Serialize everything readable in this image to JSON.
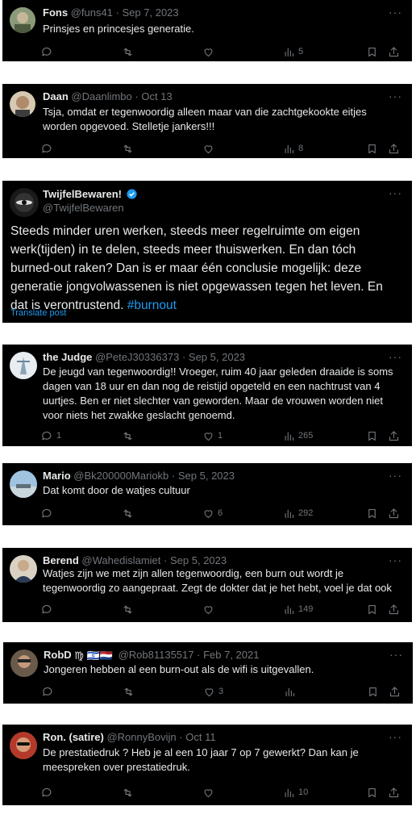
{
  "tweets": [
    {
      "name": "Fons",
      "handle": "@funs41",
      "date": "Sep 7, 2023",
      "text": "Prinsjes en princesjes generatie.",
      "replies": "",
      "reposts": "",
      "likes": "",
      "views": "5"
    },
    {
      "name": "Daan",
      "handle": "@Daanlimbo",
      "date": "Oct 13",
      "text": "Tsja, omdat er tegenwoordig alleen maar van die zachtgekookte eitjes worden opgevoed. Stelletje jankers!!!",
      "replies": "",
      "reposts": "",
      "likes": "",
      "views": "8"
    },
    {
      "name": "TwijfelBewaren!",
      "handle": "@TwijfelBewaren",
      "text": "Steeds minder uren werken, steeds meer regelruimte om eigen werk(tijden) in te delen, steeds meer thuiswerken. En dan tóch burned-out raken? Dan is er maar één conclusie mogelijk: deze generatie jongvolwassenen is niet opgewassen tegen het leven. En dat is verontrustend.",
      "hashtag": "#burnout",
      "translate": "Translate post"
    },
    {
      "name": "the Judge",
      "handle": "@PeteJ30336373",
      "date": "Sep 5, 2023",
      "text": "De jeugd van tegenwoordig!! Vroeger, ruim 40 jaar geleden draaide is soms dagen van 18 uur en dan nog de reistijd opgeteld en een nachtrust van 4 uurtjes. Ben er niet slechter van geworden. Maar de vrouwen worden niet voor niets het zwakke geslacht genoemd.",
      "replies": "1",
      "reposts": "",
      "likes": "1",
      "views": "265"
    },
    {
      "name": "Mario",
      "handle": "@Bk200000Mariokb",
      "date": "Sep 5, 2023",
      "text": "Dat komt door de watjes cultuur",
      "replies": "",
      "reposts": "",
      "likes": "6",
      "views": "292"
    },
    {
      "name": "Berend",
      "handle": "@Wahedislamiet",
      "date": "Sep 5, 2023",
      "text": "Watjes zijn we met zijn allen tegenwoordig, een burn out wordt je tegenwoordig zo aangepraat. Zegt de dokter dat je het hebt, voel je dat ook",
      "replies": "",
      "reposts": "",
      "likes": "",
      "views": "149"
    },
    {
      "name": "RobD",
      "emojis": "♍ 🇮🇱🇳🇱",
      "handle": "@Rob81135517",
      "date": "Feb 7, 2021",
      "text": "Jongeren hebben al een burn-out als de wifi is uitgevallen.",
      "replies": "",
      "reposts": "",
      "likes": "3",
      "views": ""
    },
    {
      "name": "Ron. (satire)",
      "handle": "@RonnyBovijn",
      "date": "Oct 11",
      "text": "De prestatiedruk ? Heb je al een 10 jaar 7 op 7 gewerkt? Dan kan je meespreken over prestatiedruk.",
      "replies": "",
      "reposts": "",
      "likes": "",
      "views": "10"
    }
  ],
  "separator": "·",
  "more_label": "···",
  "icons": [
    "reply-icon",
    "repost-icon",
    "like-icon",
    "views-icon",
    "bookmark-icon",
    "share-icon",
    "verified-badge-icon",
    "more-icon"
  ],
  "colors": {
    "background": "#000000",
    "text": "#e7e9ea",
    "muted": "#71767b",
    "link": "#1d9bf0",
    "gap": "#ffffff"
  }
}
